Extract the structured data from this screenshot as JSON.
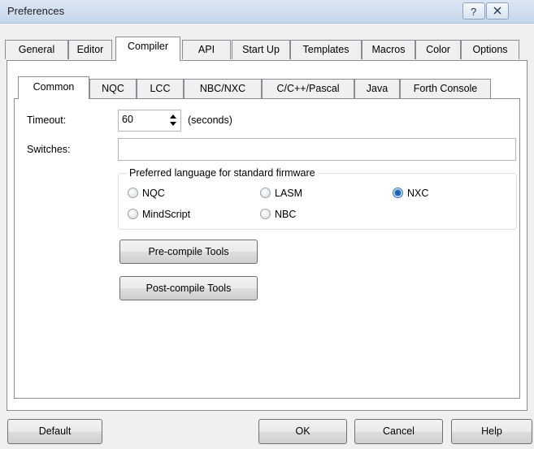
{
  "window": {
    "title": "Preferences",
    "help_icon": "question-mark-icon",
    "close_icon": "close-icon"
  },
  "outer_tabs": [
    {
      "label": "General"
    },
    {
      "label": "Editor"
    },
    {
      "label": "Compiler"
    },
    {
      "label": "API"
    },
    {
      "label": "Start Up"
    },
    {
      "label": "Templates"
    },
    {
      "label": "Macros"
    },
    {
      "label": "Color"
    },
    {
      "label": "Options"
    }
  ],
  "active_outer_tab": "Compiler",
  "inner_tabs": [
    {
      "label": "Common"
    },
    {
      "label": "NQC"
    },
    {
      "label": "LCC"
    },
    {
      "label": "NBC/NXC"
    },
    {
      "label": "C/C++/Pascal"
    },
    {
      "label": "Java"
    },
    {
      "label": "Forth Console"
    }
  ],
  "active_inner_tab": "Common",
  "form": {
    "timeout_label": "Timeout:",
    "timeout_value": "60",
    "timeout_unit": "(seconds)",
    "switches_label": "Switches:",
    "switches_value": ""
  },
  "language_group": {
    "legend": "Preferred language for standard firmware",
    "options": [
      {
        "label": "NQC",
        "selected": false
      },
      {
        "label": "LASM",
        "selected": false
      },
      {
        "label": "NXC",
        "selected": true
      },
      {
        "label": "MindScript",
        "selected": false
      },
      {
        "label": "NBC",
        "selected": false
      }
    ]
  },
  "buttons": {
    "precompile": "Pre-compile Tools",
    "postcompile": "Post-compile Tools",
    "default": "Default",
    "ok": "OK",
    "cancel": "Cancel",
    "help": "Help"
  }
}
